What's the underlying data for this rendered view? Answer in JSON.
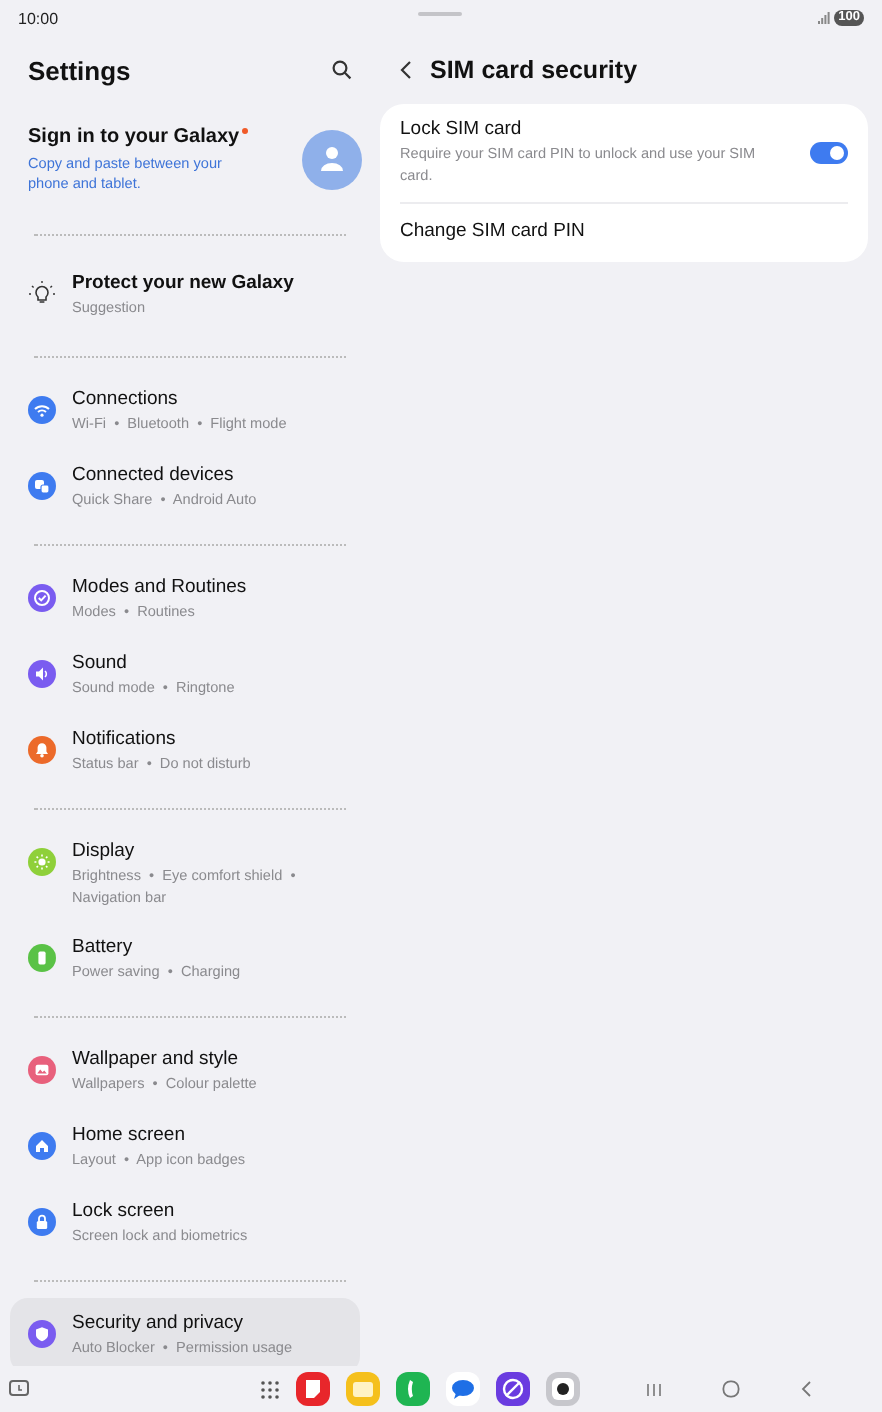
{
  "status_bar": {
    "time": "10:00",
    "battery": "100"
  },
  "settings": {
    "title": "Settings",
    "account": {
      "title": "Sign in to your Galaxy",
      "badge": true,
      "subtitle": "Copy and paste between your phone and tablet."
    },
    "groups": [
      {
        "items": [
          {
            "kind": "bulb",
            "title": "Protect your new Galaxy",
            "subtitle": "Suggestion",
            "selected": false
          }
        ]
      },
      {
        "items": [
          {
            "kind": "wifi",
            "color": "#3e7bf0",
            "title": "Connections",
            "subtitle": "Wi-Fi  •  Bluetooth  •  Flight mode",
            "selected": false
          },
          {
            "kind": "devices",
            "color": "#3e7bf0",
            "title": "Connected devices",
            "subtitle": "Quick Share  •  Android Auto",
            "selected": false
          }
        ]
      },
      {
        "items": [
          {
            "kind": "check",
            "color": "#7a5cf0",
            "title": "Modes and Routines",
            "subtitle": "Modes  •  Routines",
            "selected": false
          },
          {
            "kind": "speaker",
            "color": "#7a5cf0",
            "title": "Sound",
            "subtitle": "Sound mode  •  Ringtone",
            "selected": false
          },
          {
            "kind": "bell",
            "color": "#ec6a2a",
            "title": "Notifications",
            "subtitle": "Status bar  •  Do not disturb",
            "selected": false
          }
        ]
      },
      {
        "items": [
          {
            "kind": "sun",
            "color": "#8fd03a",
            "title": "Display",
            "subtitle": "Brightness  •  Eye comfort shield  •  Navigation bar",
            "selected": false
          },
          {
            "kind": "battery",
            "color": "#5ac246",
            "title": "Battery",
            "subtitle": "Power saving  •  Charging",
            "selected": false
          }
        ]
      },
      {
        "items": [
          {
            "kind": "image",
            "color": "#e8607c",
            "title": "Wallpaper and style",
            "subtitle": "Wallpapers  •  Colour palette",
            "selected": false
          },
          {
            "kind": "home",
            "color": "#3e7bf0",
            "title": "Home screen",
            "subtitle": "Layout  •  App icon badges",
            "selected": false
          },
          {
            "kind": "lock",
            "color": "#3e7bf0",
            "title": "Lock screen",
            "subtitle": "Screen lock and biometrics",
            "selected": false
          }
        ]
      },
      {
        "items": [
          {
            "kind": "shield",
            "color": "#7a5cf0",
            "title": "Security and privacy",
            "subtitle": "Auto Blocker  •  Permission usage",
            "selected": true
          }
        ]
      }
    ]
  },
  "detail": {
    "title": "SIM card security",
    "rows": [
      {
        "kind": "toggle",
        "title": "Lock SIM card",
        "description": "Require your SIM card PIN to unlock and use your SIM card.",
        "on": true
      },
      {
        "kind": "link",
        "title": "Change SIM card PIN"
      }
    ]
  }
}
